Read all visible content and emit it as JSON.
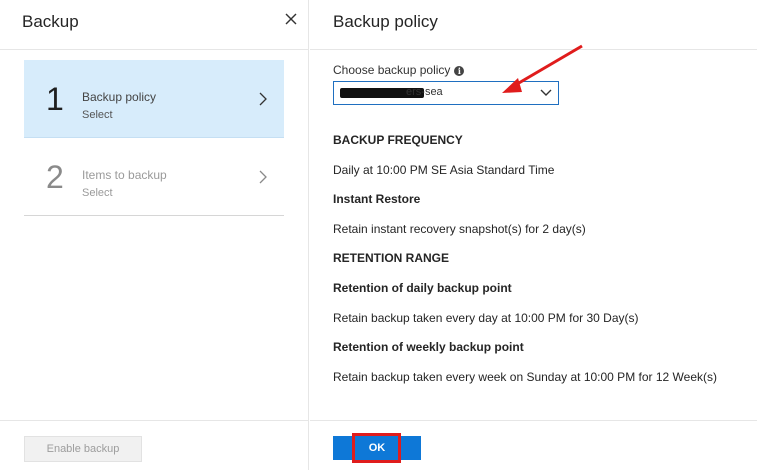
{
  "left_blade": {
    "title": "Backup",
    "steps": [
      {
        "number": "1",
        "title": "Backup policy",
        "subtitle": "Select",
        "active": true
      },
      {
        "number": "2",
        "title": "Items to backup",
        "subtitle": "Select",
        "active": false
      }
    ],
    "enable_button_label": "Enable backup"
  },
  "right_blade": {
    "title": "Backup policy",
    "choose_label": "Choose backup policy",
    "select_value_visible": "ers-sea",
    "backup_frequency_heading": "BACKUP FREQUENCY",
    "backup_frequency_text": "Daily at 10:00 PM SE Asia Standard Time",
    "instant_restore_heading": "Instant Restore",
    "instant_restore_text": "Retain instant recovery snapshot(s) for 2 day(s)",
    "retention_range_heading": "RETENTION RANGE",
    "daily_heading": "Retention of daily backup point",
    "daily_text": "Retain backup taken every day at 10:00 PM for 30 Day(s)",
    "weekly_heading": "Retention of weekly backup point",
    "weekly_text": "Retain backup taken every week on Sunday at 10:00 PM for 12 Week(s)",
    "ok_label": "OK"
  },
  "icons": {
    "close": "close-icon",
    "chevron": "chevron-right-icon",
    "info": "info-icon",
    "dropdown": "chevron-down-icon",
    "annotation": "red-arrow-annotation"
  },
  "colors": {
    "active_step_bg": "#d7ecfb",
    "primary_button": "#0e78d7",
    "annotation_red": "#e01c1c"
  }
}
